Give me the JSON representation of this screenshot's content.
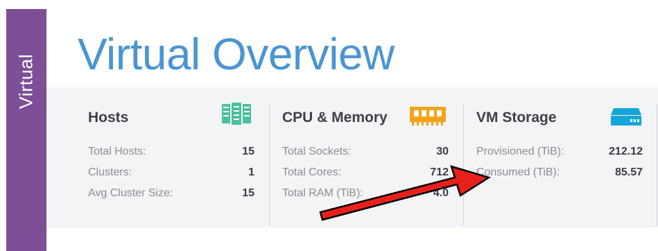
{
  "sidebar": {
    "tab_label": "Virtual"
  },
  "header": {
    "title": "Virtual Overview"
  },
  "colors": {
    "sidebar_bg": "#7d4f97",
    "title_color": "#4a95d1",
    "panel_bg": "#f3f4f6",
    "hosts_icon": "#4bbf9f",
    "cpu_icon": "#f3a21a",
    "storage_icon": "#14a6d8",
    "annotation_arrow": "#e8201c"
  },
  "cards": {
    "hosts": {
      "title": "Hosts",
      "icon": "server-rack-icon",
      "rows": [
        {
          "label": "Total Hosts:",
          "value": "15"
        },
        {
          "label": "Clusters:",
          "value": "1"
        },
        {
          "label": "Avg Cluster Size:",
          "value": "15"
        }
      ]
    },
    "cpu_memory": {
      "title": "CPU & Memory",
      "icon": "memory-chip-icon",
      "rows": [
        {
          "label": "Total Sockets:",
          "value": "30"
        },
        {
          "label": "Total Cores:",
          "value": "712"
        },
        {
          "label": "Total RAM (TiB):",
          "value": "4.0"
        }
      ]
    },
    "vm_storage": {
      "title": "VM Storage",
      "icon": "storage-drive-icon",
      "rows": [
        {
          "label": "Provisioned (TiB):",
          "value": "212.12"
        },
        {
          "label": "Consumed (TiB):",
          "value": "85.57"
        }
      ]
    }
  },
  "annotation": {
    "icon": "red-arrow-icon"
  }
}
